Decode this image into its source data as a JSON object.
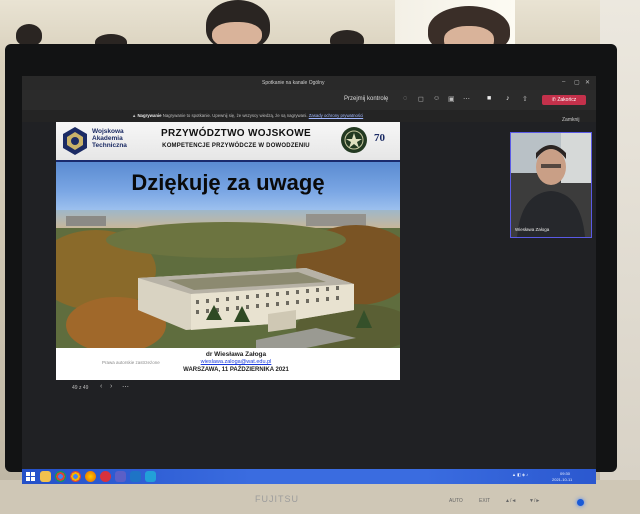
{
  "window": {
    "title": "Spotkanie na kanale Ogólny"
  },
  "toolbar": {
    "take_control": "Przejmij kontrolę",
    "leave": "Zakończ"
  },
  "notice": {
    "recording": "Nagrywanie",
    "text": "Nagrywanie to spotkanie. Upewnij się, że wszyscy wiedzą, że są nagrywani.",
    "policy_link": "Zasady ochrony prywatności"
  },
  "slide": {
    "university": [
      "Wojskowa",
      "Akademia",
      "Techniczna"
    ],
    "main_title": "PRZYWÓDZTWO WOJSKOWE",
    "sub_title": "KOMPETENCJE PRZYWÓDCZE W DOWODZENIU",
    "anniversary": "70",
    "thanks": "Dziękuję za uwagę",
    "rights": "Prawa autorskie zastrzeżone",
    "author": "dr Wiesława Załoga",
    "email": "wieslawa.zaloga@wat.edu.pl",
    "place_date": "WARSZAWA, 11 PAŹDZIERNIKA 2021"
  },
  "presentation": {
    "page": "49 z 49"
  },
  "participant": {
    "close": "Zamknij",
    "name": "Wiesława Załoga"
  },
  "tray": {
    "time": "09:30",
    "date": "2021-10-11"
  },
  "monitor": {
    "brand": "FUJITSU",
    "buttons": [
      "AUTO",
      "EXIT",
      "▲/◄",
      "▼/►"
    ]
  },
  "colors": {
    "taskbar": "#3a6ce0",
    "leave": "#c4314b",
    "slide_navy": "#1b2b64"
  }
}
